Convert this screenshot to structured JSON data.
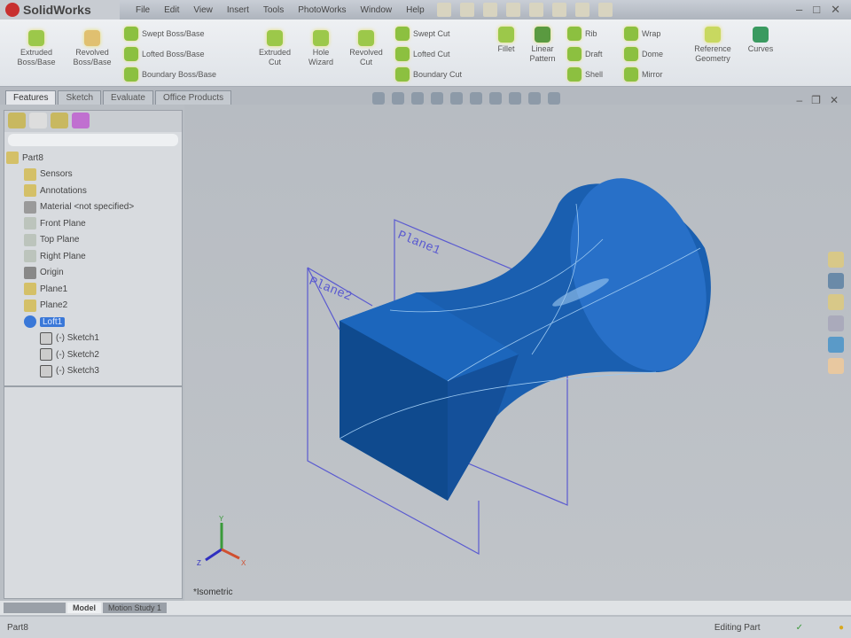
{
  "app": {
    "title": "SolidWorks"
  },
  "menu": [
    "File",
    "Edit",
    "View",
    "Insert",
    "Tools",
    "PhotoWorks",
    "Window",
    "Help"
  ],
  "ribbon": {
    "large": [
      {
        "label1": "Extruded",
        "label2": "Boss/Base"
      },
      {
        "label1": "Revolved",
        "label2": "Boss/Base"
      },
      {
        "label1": "Extruded",
        "label2": "Cut"
      },
      {
        "label1": "Hole",
        "label2": "Wizard"
      },
      {
        "label1": "Revolved",
        "label2": "Cut"
      },
      {
        "label1": "Fillet",
        "label2": ""
      },
      {
        "label1": "Linear",
        "label2": "Pattern"
      },
      {
        "label1": "Reference",
        "label2": "Geometry"
      },
      {
        "label1": "Curves",
        "label2": ""
      }
    ],
    "small": [
      "Swept Boss/Base",
      "Lofted Boss/Base",
      "Boundary Boss/Base",
      "Swept Cut",
      "Lofted Cut",
      "Boundary Cut",
      "Rib",
      "Draft",
      "Shell",
      "Wrap",
      "Dome",
      "Mirror"
    ]
  },
  "tabs": [
    "Features",
    "Sketch",
    "Evaluate",
    "Office Products"
  ],
  "tree": {
    "root": "Part8",
    "items": [
      "Sensors",
      "Annotations",
      "Material <not specified>",
      "Front Plane",
      "Top Plane",
      "Right Plane",
      "Origin",
      "Plane1",
      "Plane2"
    ],
    "selected": "Loft1",
    "children": [
      "(-) Sketch1",
      "(-) Sketch2",
      "(-) Sketch3"
    ]
  },
  "viewport": {
    "plane1": "Plane1",
    "plane2": "Plane2",
    "view": "*Isometric",
    "axes": {
      "x": "X",
      "y": "Y",
      "z": "Z"
    }
  },
  "bottom_tabs": [
    "Model",
    "Motion Study 1"
  ],
  "status": {
    "left": "Part8",
    "mode": "Editing Part"
  },
  "colors": {
    "part": "#1a5fb0",
    "plane": "#5a5ad0"
  }
}
